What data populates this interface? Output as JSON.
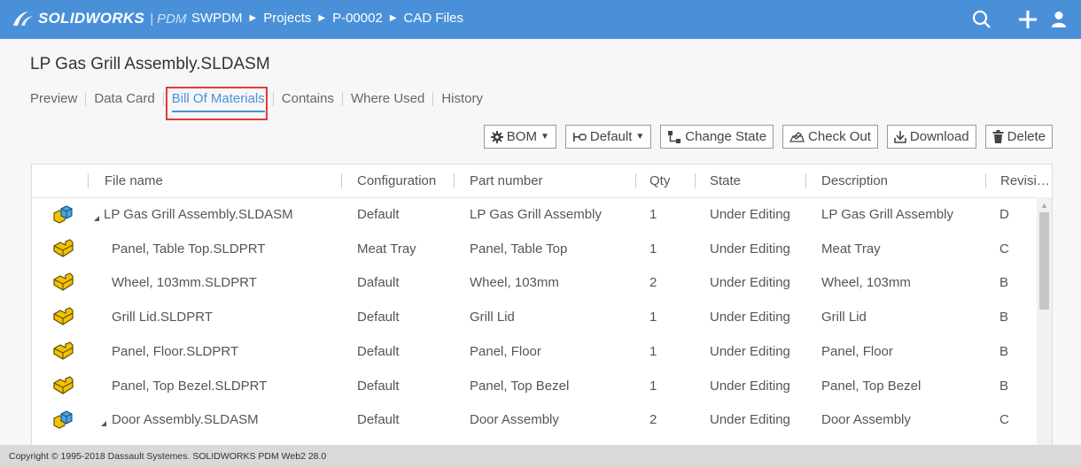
{
  "header": {
    "brand": "SOLIDWORKS",
    "product": "| PDM",
    "breadcrumbs": [
      "SWPDM",
      "Projects",
      "P-00002",
      "CAD Files"
    ]
  },
  "page": {
    "title": "LP Gas Grill Assembly.SLDASM"
  },
  "tabs": [
    {
      "label": "Preview"
    },
    {
      "label": "Data Card"
    },
    {
      "label": "Bill Of Materials"
    },
    {
      "label": "Contains"
    },
    {
      "label": "Where Used"
    },
    {
      "label": "History"
    }
  ],
  "toolbar": {
    "bom": "BOM",
    "default": "Default",
    "change_state": "Change State",
    "check_out": "Check Out",
    "download": "Download",
    "delete": "Delete"
  },
  "table": {
    "columns": [
      "File name",
      "Configuration",
      "Part number",
      "Qty",
      "State",
      "Description",
      "Revisi…"
    ],
    "rows": [
      {
        "icon": "assembly",
        "expand": true,
        "file": "LP Gas Grill Assembly.SLDASM",
        "config": "Default",
        "part": "LP Gas Grill Assembly",
        "qty": "1",
        "state": "Under Editing",
        "desc": "LP Gas Grill Assembly",
        "rev": "D"
      },
      {
        "icon": "part",
        "expand": false,
        "file": "Panel, Table Top.SLDPRT",
        "config": "Meat Tray",
        "part": "Panel, Table Top",
        "qty": "1",
        "state": "Under Editing",
        "desc": "Meat Tray",
        "rev": "C"
      },
      {
        "icon": "part",
        "expand": false,
        "file": "Wheel, 103mm.SLDPRT",
        "config": "Dafault",
        "part": "Wheel, 103mm",
        "qty": "2",
        "state": "Under Editing",
        "desc": "Wheel, 103mm",
        "rev": "B"
      },
      {
        "icon": "part",
        "expand": false,
        "file": "Grill Lid.SLDPRT",
        "config": "Default",
        "part": "Grill Lid",
        "qty": "1",
        "state": "Under Editing",
        "desc": "Grill Lid",
        "rev": "B"
      },
      {
        "icon": "part",
        "expand": false,
        "file": "Panel, Floor.SLDPRT",
        "config": "Default",
        "part": "Panel, Floor",
        "qty": "1",
        "state": "Under Editing",
        "desc": "Panel, Floor",
        "rev": "B"
      },
      {
        "icon": "part",
        "expand": false,
        "file": "Panel, Top Bezel.SLDPRT",
        "config": "Default",
        "part": "Panel, Top Bezel",
        "qty": "1",
        "state": "Under Editing",
        "desc": "Panel, Top Bezel",
        "rev": "B"
      },
      {
        "icon": "assembly",
        "expand": true,
        "file": "Door Assembly.SLDASM",
        "config": "Default",
        "part": "Door Assembly",
        "qty": "2",
        "state": "Under Editing",
        "desc": "Door Assembly",
        "rev": "C"
      }
    ]
  },
  "footer": {
    "copyright": "Copyright © 1995-2018 Dassault Systemes. SOLIDWORKS PDM Web2 28.0"
  },
  "colors": {
    "topbar": "#4a90d9",
    "accent": "#4a90d9",
    "highlight": "#e53935",
    "part_icon": "#f2c200",
    "assembly_icon": "#4aa3df"
  },
  "icons": {
    "search": "search-icon",
    "add": "plus-icon",
    "user": "user-icon"
  }
}
